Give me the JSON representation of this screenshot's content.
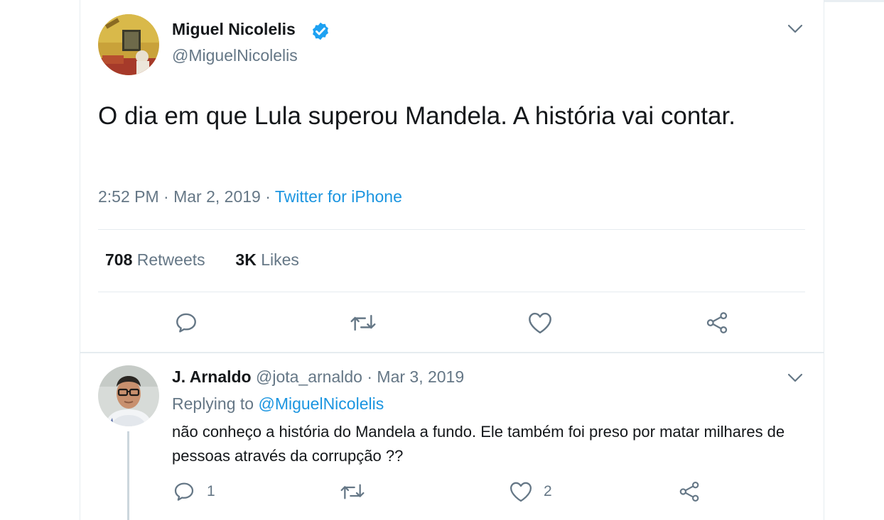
{
  "main_tweet": {
    "author_name": "Miguel Nicolelis",
    "handle": "@MiguelNicolelis",
    "verified": true,
    "text": "O dia em que Lula superou Mandela. A história vai contar.",
    "time": "2:52 PM",
    "date": "Mar 2, 2019",
    "source": "Twitter for iPhone",
    "retweets_count": "708",
    "retweets_label": "Retweets",
    "likes_count": "3K",
    "likes_label": "Likes"
  },
  "reply": {
    "author_name": "J. Arnaldo",
    "handle": "@jota_arnaldo",
    "date": "Mar 3, 2019",
    "replying_prefix": "Replying to",
    "replying_to": "@MiguelNicolelis",
    "text": "não conheço a história do Mandela a fundo. Ele também foi preso por matar milhares de pessoas através da corrupção ??",
    "reply_count": "1",
    "like_count": "2"
  },
  "colors": {
    "link": "#1b95e0",
    "secondary_text": "#657786",
    "primary_text": "#14171a",
    "border": "#e6ecf0"
  }
}
